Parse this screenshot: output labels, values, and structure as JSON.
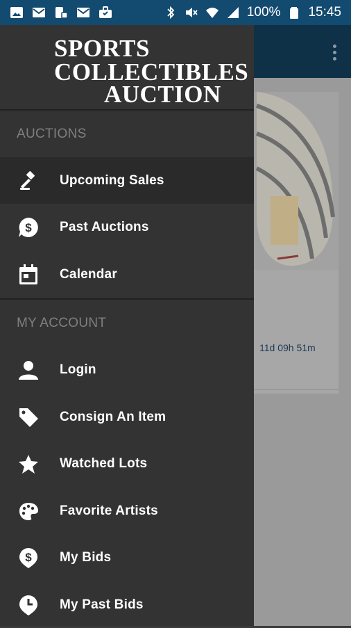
{
  "status_bar": {
    "battery": "100%",
    "time": "15:45",
    "left_icons": [
      "image-icon",
      "mail-icon",
      "phone-icon",
      "mail-icon",
      "briefcase-icon"
    ],
    "right_icons": [
      "bluetooth-icon",
      "mute-icon",
      "wifi-icon",
      "signal-icon",
      "battery-icon"
    ]
  },
  "app": {
    "timer": "11d 09h 51m"
  },
  "drawer": {
    "logo": {
      "line1": "SPORTS",
      "line2": "COLLECTIBLES",
      "line3": "AUCTION"
    },
    "sections": [
      {
        "title": "AUCTIONS",
        "items": [
          {
            "label": "Upcoming Sales",
            "icon": "gavel-icon",
            "active": true
          },
          {
            "label": "Past Auctions",
            "icon": "dollar-bubble-icon",
            "active": false
          },
          {
            "label": "Calendar",
            "icon": "calendar-icon",
            "active": false
          }
        ]
      },
      {
        "title": "MY ACCOUNT",
        "items": [
          {
            "label": "Login",
            "icon": "person-icon"
          },
          {
            "label": "Consign An Item",
            "icon": "tag-icon"
          },
          {
            "label": "Watched Lots",
            "icon": "star-icon"
          },
          {
            "label": "Favorite Artists",
            "icon": "palette-icon"
          },
          {
            "label": "My Bids",
            "icon": "dollar-pin-icon"
          },
          {
            "label": "My Past Bids",
            "icon": "clock-pin-icon"
          }
        ]
      }
    ]
  }
}
